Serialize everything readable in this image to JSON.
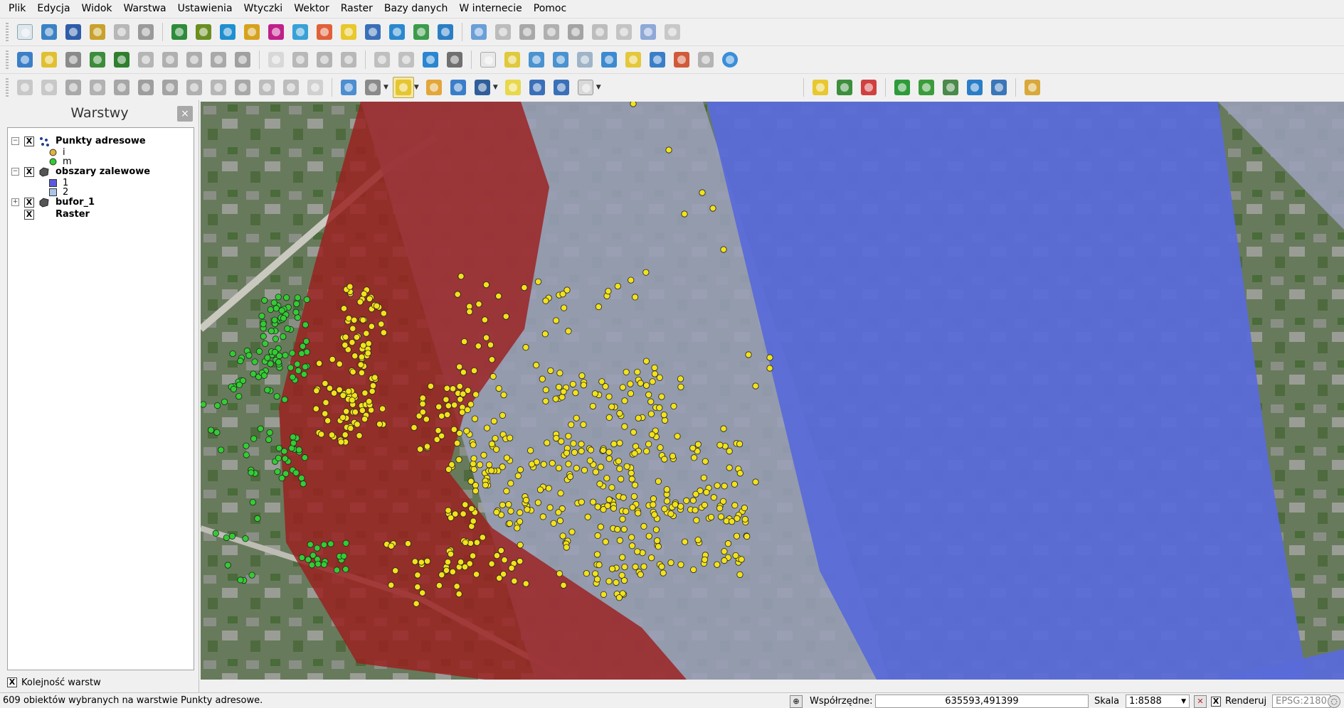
{
  "menu": [
    "Plik",
    "Edycja",
    "Widok",
    "Warstwa",
    "Ustawienia",
    "Wtyczki",
    "Wektor",
    "Raster",
    "Bazy danych",
    "W internecie",
    "Pomoc"
  ],
  "panel": {
    "title": "Warstwy",
    "close": "×",
    "footer_label": "Kolejność warstw",
    "check": "X"
  },
  "layers": {
    "points": {
      "name": "Punkty adresowe",
      "expander": "−",
      "legend": [
        {
          "label": "i",
          "color": "#e0b33a"
        },
        {
          "label": "m",
          "color": "#33cc33"
        }
      ]
    },
    "flood": {
      "name": "obszary zalewowe",
      "expander": "−",
      "legend": [
        {
          "label": "1",
          "color": "#5a5adf"
        },
        {
          "label": "2",
          "color": "#a9c6e6"
        }
      ]
    },
    "buffer": {
      "name": "bufor_1",
      "expander": "+"
    },
    "raster": {
      "name": "Raster"
    }
  },
  "status": {
    "message": "609 obiektów wybranych na warstwie Punkty adresowe.",
    "coord_label": "Współrzędne:",
    "coord_value": "635593,491399",
    "scale_label": "Skala",
    "scale_value": "1:8588",
    "render_label": "Renderuj",
    "crs": "EPSG:2180"
  },
  "colors": {
    "flood_zone_1": "#5a6bd8",
    "buffer": "#9a9fb8",
    "flood_zone_red": "#9b1f1f",
    "point_i": "#f2e21b",
    "point_m": "#33cc33"
  }
}
